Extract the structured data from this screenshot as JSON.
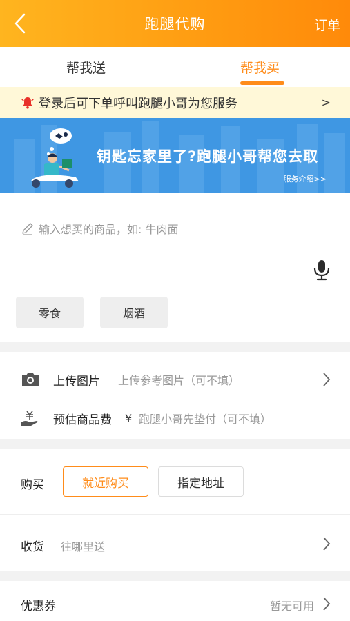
{
  "header": {
    "title": "跑腿代购",
    "right_action": "订单"
  },
  "tabs": [
    {
      "label": "帮我送"
    },
    {
      "label": "帮我买"
    }
  ],
  "notice": {
    "text": "登录后可下单呼叫跑腿小哥为您服务",
    "arrow": ">"
  },
  "banner": {
    "slogan": "钥匙忘家里了?跑腿小哥帮您去取",
    "link": "服务介绍>>"
  },
  "item_input": {
    "placeholder": "输入想买的商品，如: 牛肉面"
  },
  "quick_tags": [
    "零食",
    "烟酒"
  ],
  "upload": {
    "label": "上传图片",
    "hint": "上传参考图片（可不填）"
  },
  "estimate": {
    "label": "预估商品费",
    "currency": "¥",
    "hint": "跑腿小哥先垫付（可不填）"
  },
  "purchase": {
    "label": "购买",
    "options": [
      "就近购买",
      "指定地址"
    ]
  },
  "receive": {
    "label": "收货",
    "hint": "往哪里送"
  },
  "coupon": {
    "label": "优惠券",
    "value": "暂无可用"
  },
  "colors": {
    "accent": "#ff8c1a",
    "header_start": "#ffb51f",
    "header_end": "#ff8a0a",
    "banner": "#3f97e3",
    "notice_bg": "#fff8d8"
  }
}
